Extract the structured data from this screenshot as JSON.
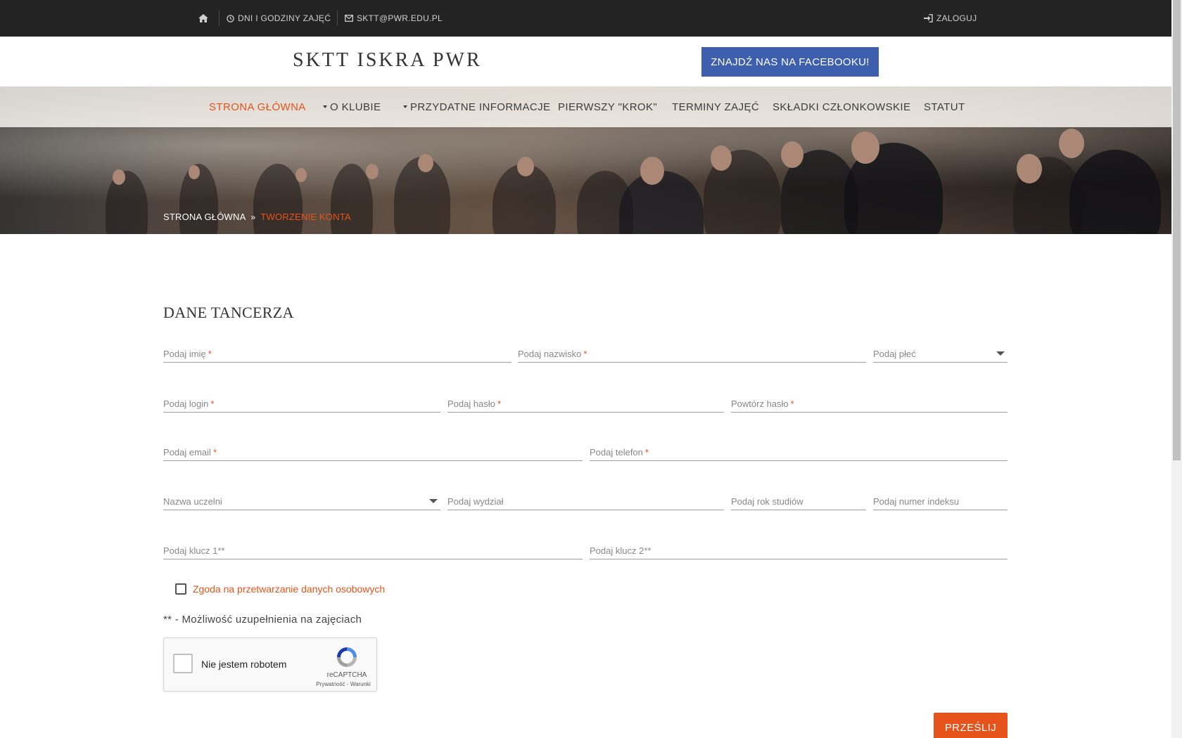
{
  "topbar": {
    "home_icon": "home-icon",
    "schedule_icon": "clock-icon",
    "schedule_label": "DNI I GODZINY ZAJĘĆ",
    "email_icon": "envelope-icon",
    "email_label": "SKTT@PWR.EDU.PL",
    "login_icon": "sign-in-icon",
    "login_label": "ZALOGUJ"
  },
  "header": {
    "logo": "SKTT ISKRA PWR",
    "facebook_button": "ZNAJDŹ NAS NA FACEBOOKU!"
  },
  "nav": {
    "items": [
      {
        "label": "STRONA GŁÓWNA",
        "active": true
      },
      {
        "label": "O KLUBIE",
        "dropdown": true
      },
      {
        "label": "PRZYDATNE INFORMACJE",
        "dropdown": true
      },
      {
        "label": "PIERWSZY \"KROK\""
      },
      {
        "label": "TERMINY ZAJĘĆ"
      },
      {
        "label": "SKŁADKI CZŁONKOWSKIE"
      },
      {
        "label": "STATUT"
      }
    ]
  },
  "breadcrumb": {
    "home": "STRONA GŁÓWNA",
    "separator": "»",
    "current": "TWORZENIE KONTA"
  },
  "form": {
    "title": "DANE TANCERZA",
    "fields": {
      "first_name": {
        "placeholder": "Podaj imię",
        "required": "*"
      },
      "last_name": {
        "placeholder": "Podaj nazwisko",
        "required": "*"
      },
      "gender": {
        "placeholder": "Podaj płeć"
      },
      "login": {
        "placeholder": "Podaj login",
        "required": "*"
      },
      "password": {
        "placeholder": "Podaj hasło",
        "required": "*"
      },
      "password_repeat": {
        "placeholder": "Powtórz hasło",
        "required": "*"
      },
      "email": {
        "placeholder": "Podaj email",
        "required": "*"
      },
      "phone": {
        "placeholder": "Podaj telefon",
        "required": "*"
      },
      "university": {
        "placeholder": "Nazwa uczelni"
      },
      "faculty": {
        "placeholder": "Podaj wydział"
      },
      "year": {
        "placeholder": "Podaj rok studiów"
      },
      "index": {
        "placeholder": "Podaj numer indeksu"
      },
      "key1": {
        "placeholder": "Podaj klucz 1**"
      },
      "key2": {
        "placeholder": "Podaj klucz 2**"
      }
    },
    "consent_label": "Zgoda na przetwarzanie danych osobowych",
    "note": "** - Możliwość uzupełnienia na zajęciach",
    "recaptcha": {
      "label": "Nie jestem robotem",
      "brand": "reCAPTCHA",
      "links": "Prywatność - Warunki"
    },
    "submit_label": "PRZEŚLIJ"
  },
  "colors": {
    "accent": "#e5531a",
    "facebook": "#3d5fae",
    "topbar": "#232323"
  }
}
